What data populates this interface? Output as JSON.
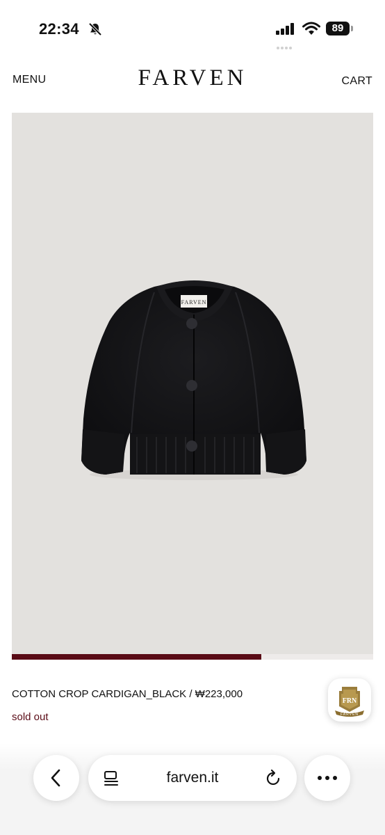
{
  "status_bar": {
    "time": "22:34",
    "battery": "89"
  },
  "header": {
    "menu_label": "MENU",
    "logo": "FARVEN",
    "cart_label": "CART"
  },
  "product_image": {
    "tag_text": "FARVEN",
    "gallery_progress": 0.69
  },
  "product": {
    "name": "COTTON CROP CARDIGAN_BLACK / ₩223,000",
    "stock_status": "sold out"
  },
  "badge": {
    "monogram": "FRN",
    "brand": "FARVEN"
  },
  "browser": {
    "url": "farven.it"
  },
  "colors": {
    "accent": "#5a0b16",
    "image_bg": "#e3e1de"
  }
}
